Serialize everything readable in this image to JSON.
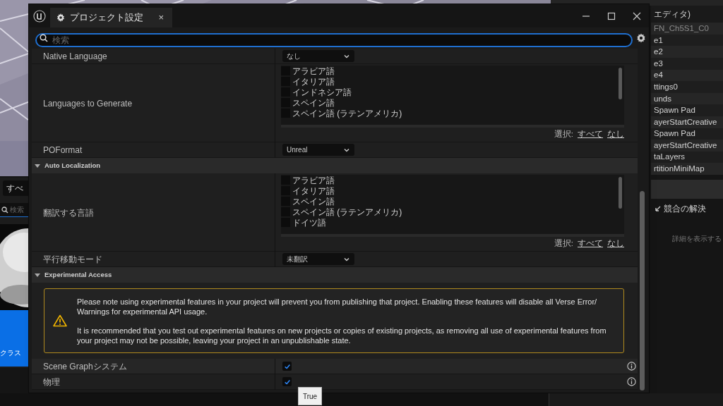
{
  "window": {
    "title": "プロジェクト設定",
    "tab_close": "×"
  },
  "search": {
    "placeholder": "検索"
  },
  "sections": [
    {
      "rows": [
        {
          "kind": "dropdown",
          "label": "Native Language",
          "value": "なし"
        },
        {
          "kind": "checklist",
          "label": "Languages to Generate",
          "items": [
            {
              "label": "アラビア語",
              "checked": false
            },
            {
              "label": "イタリア語",
              "checked": false
            },
            {
              "label": "インドネシア語",
              "checked": false
            },
            {
              "label": "スペイン語",
              "checked": false
            },
            {
              "label": "スペイン語 (ラテンアメリカ)",
              "checked": false
            }
          ],
          "select_label": "選択:",
          "select_all": "すべて",
          "select_none": "なし"
        },
        {
          "kind": "dropdown",
          "label": "POFormat",
          "value": "Unreal"
        }
      ]
    },
    {
      "title": "Auto Localization",
      "expanded": true,
      "rows": [
        {
          "kind": "checklist",
          "label": "翻訳する言語",
          "items": [
            {
              "label": "アラビア語",
              "checked": false
            },
            {
              "label": "イタリア語",
              "checked": false
            },
            {
              "label": "スペイン語",
              "checked": false
            },
            {
              "label": "スペイン語 (ラテンアメリカ)",
              "checked": false
            },
            {
              "label": "ドイツ語",
              "checked": false
            }
          ],
          "select_label": "選択:",
          "select_all": "すべて",
          "select_none": "なし"
        },
        {
          "kind": "dropdown",
          "label": "平行移動モード",
          "value": "未翻訳"
        }
      ]
    },
    {
      "title": "Experimental Access",
      "expanded": true,
      "rows": [
        {
          "kind": "notice",
          "paragraphs": [
            "Please note using experimental features in your project will prevent you from publishing that project. Enabling these features will disable all Verse Error/ Warnings for experimental API usage.",
            "It is recommended that you test out experimental features on new projects or copies of existing projects, as removing all use of experimental features from your project may not be possible, leaving your project in an unpublishable state."
          ]
        },
        {
          "kind": "checkbox",
          "label": "Scene Graphシステム",
          "checked": true
        },
        {
          "kind": "checkbox",
          "label": "物理",
          "checked": true
        }
      ]
    }
  ],
  "tooltip": "True",
  "outliner": {
    "header": "エディタ)",
    "items": [
      "FN_Ch5S1_C0",
      "e1",
      "e2",
      "e3",
      "e4",
      "ttings0",
      "unds",
      "Spawn Pad",
      "ayerStartCreative",
      "Spawn Pad",
      "ayerStartCreative",
      "taLayers",
      "rtitionMiniMap"
    ]
  },
  "details": {
    "tab": "競合の解決",
    "hint": "詳細を表示する"
  },
  "content_browser": {
    "filter": "すべ",
    "search_placeholder": "検索",
    "tile_label": "クラス"
  }
}
